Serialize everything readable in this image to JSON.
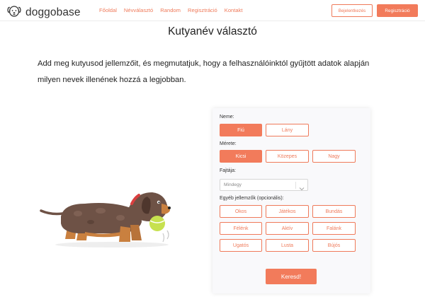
{
  "header": {
    "logo_text": "doggobase",
    "nav": [
      "Főoldal",
      "Névválasztó",
      "Random",
      "Regisztráció",
      "Kontakt"
    ],
    "login_label": "Bejelentkezés",
    "register_label": "Regisztráció"
  },
  "page": {
    "title": "Kutyanév választó",
    "intro": "Add meg kutyusod jellemzőit, és megmutatjuk, hogy a felhasználóinktól gyűjtött adatok alapján milyen nevek illenének hozzá a legjobban."
  },
  "form": {
    "gender": {
      "label": "Neme:",
      "options": [
        "Fiú",
        "Lány"
      ],
      "selected": "Fiú"
    },
    "size": {
      "label": "Mérete:",
      "options": [
        "Kicsi",
        "Közepes",
        "Nagy"
      ],
      "selected": "Kicsi"
    },
    "breed": {
      "label": "Fajtája:",
      "value": "Mindegy"
    },
    "traits": {
      "label": "Egyéb jellemzők (opcionális):",
      "options": [
        "Okos",
        "Játékos",
        "Bundás",
        "Félénk",
        "Aktív",
        "Falánk",
        "Ugatós",
        "Lusta",
        "Bújós"
      ]
    },
    "submit_label": "Keresd!"
  },
  "colors": {
    "accent": "#f27b5b",
    "dog_body": "#6e5246"
  },
  "icons": {
    "logo": "dog-face-icon",
    "select": "chevron-down-icon"
  }
}
